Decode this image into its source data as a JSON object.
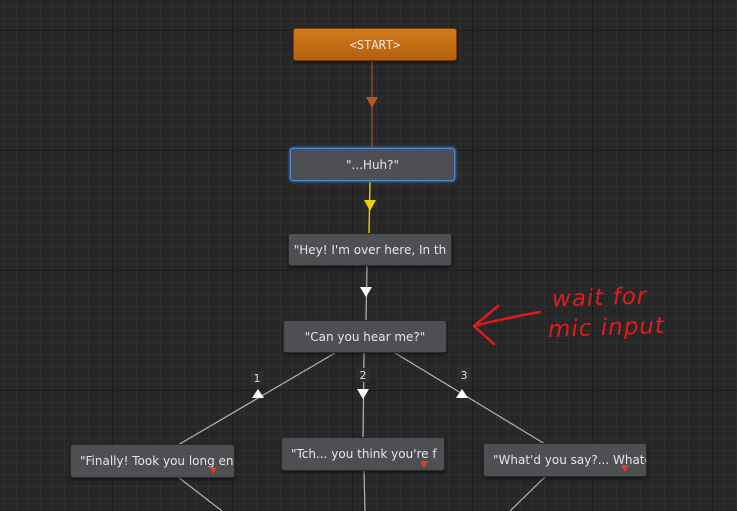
{
  "graph": {
    "start_node": {
      "label": "<START>",
      "accent": "#c96c14"
    },
    "nodes": [
      {
        "text": "\"...Huh?\"",
        "selected": true
      },
      {
        "text": "\"Hey! I'm over here, In th"
      },
      {
        "text": "\"Can you hear me?\""
      },
      {
        "text": "\"Finally! Took you long en"
      },
      {
        "text": "\"Tch... you think you're f"
      },
      {
        "text": "\"What'd you say?... Whatev"
      }
    ],
    "choice_labels": [
      "1",
      "2",
      "3"
    ],
    "connection_colors": {
      "from_start": "#8a4a1c",
      "from_selected": "#e0c200",
      "default": "#b4b4b4"
    }
  },
  "annotation": {
    "line1": "wait for",
    "line2": "mic input",
    "color": "#e01b1b"
  }
}
